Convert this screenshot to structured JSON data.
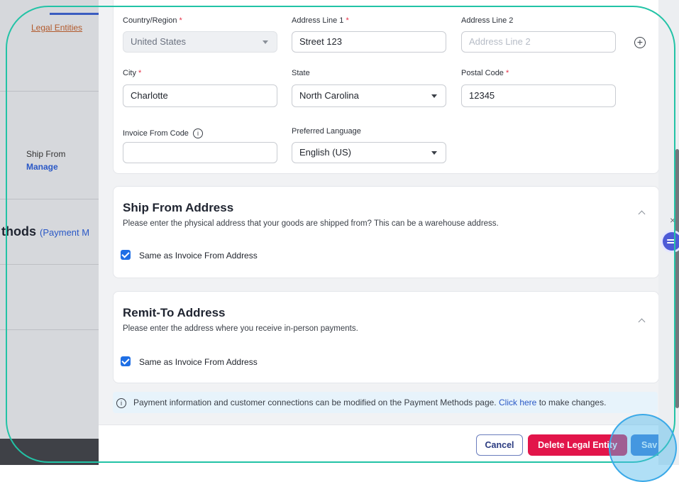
{
  "background": {
    "tab_label": "Legal Entities",
    "ship_from_label": "Ship From",
    "manage_link": "Manage",
    "section_heading": "thods",
    "section_heading_link": "(Payment M"
  },
  "form": {
    "country": {
      "label": "Country/Region",
      "value": "United States"
    },
    "address1": {
      "label": "Address Line 1",
      "value": "Street 123"
    },
    "address2": {
      "label": "Address Line 2",
      "placeholder": "Address Line 2"
    },
    "city": {
      "label": "City",
      "value": "Charlotte"
    },
    "state": {
      "label": "State",
      "value": "North Carolina"
    },
    "postal": {
      "label": "Postal Code",
      "value": "12345"
    },
    "invoice_code": {
      "label": "Invoice From Code",
      "value": ""
    },
    "language": {
      "label": "Preferred Language",
      "value": "English (US)"
    },
    "required_marker": "*",
    "plus_symbol": "+",
    "info_symbol": "i"
  },
  "ship_from": {
    "title": "Ship From Address",
    "description": "Please enter the physical address that your goods are shipped from? This can be a warehouse address.",
    "checkbox_label": "Same as Invoice From Address",
    "checked": true
  },
  "remit_to": {
    "title": "Remit-To Address",
    "description": "Please enter the address where you receive in-person payments.",
    "checkbox_label": "Same as Invoice From Address",
    "checked": true
  },
  "notice": {
    "text_before": "Payment information and customer connections can be modified on the Payment Methods page.",
    "link": "Click here",
    "text_after": "to make changes."
  },
  "footer": {
    "cancel": "Cancel",
    "delete": "Delete Legal Entity",
    "save": "Sav"
  },
  "overlay": {
    "close_symbol": "×"
  },
  "colors": {
    "primary": "#1f6fe5",
    "danger": "#e2154a",
    "link": "#2a58c6",
    "required": "#e53147",
    "magnifier": "#22c3a6"
  }
}
